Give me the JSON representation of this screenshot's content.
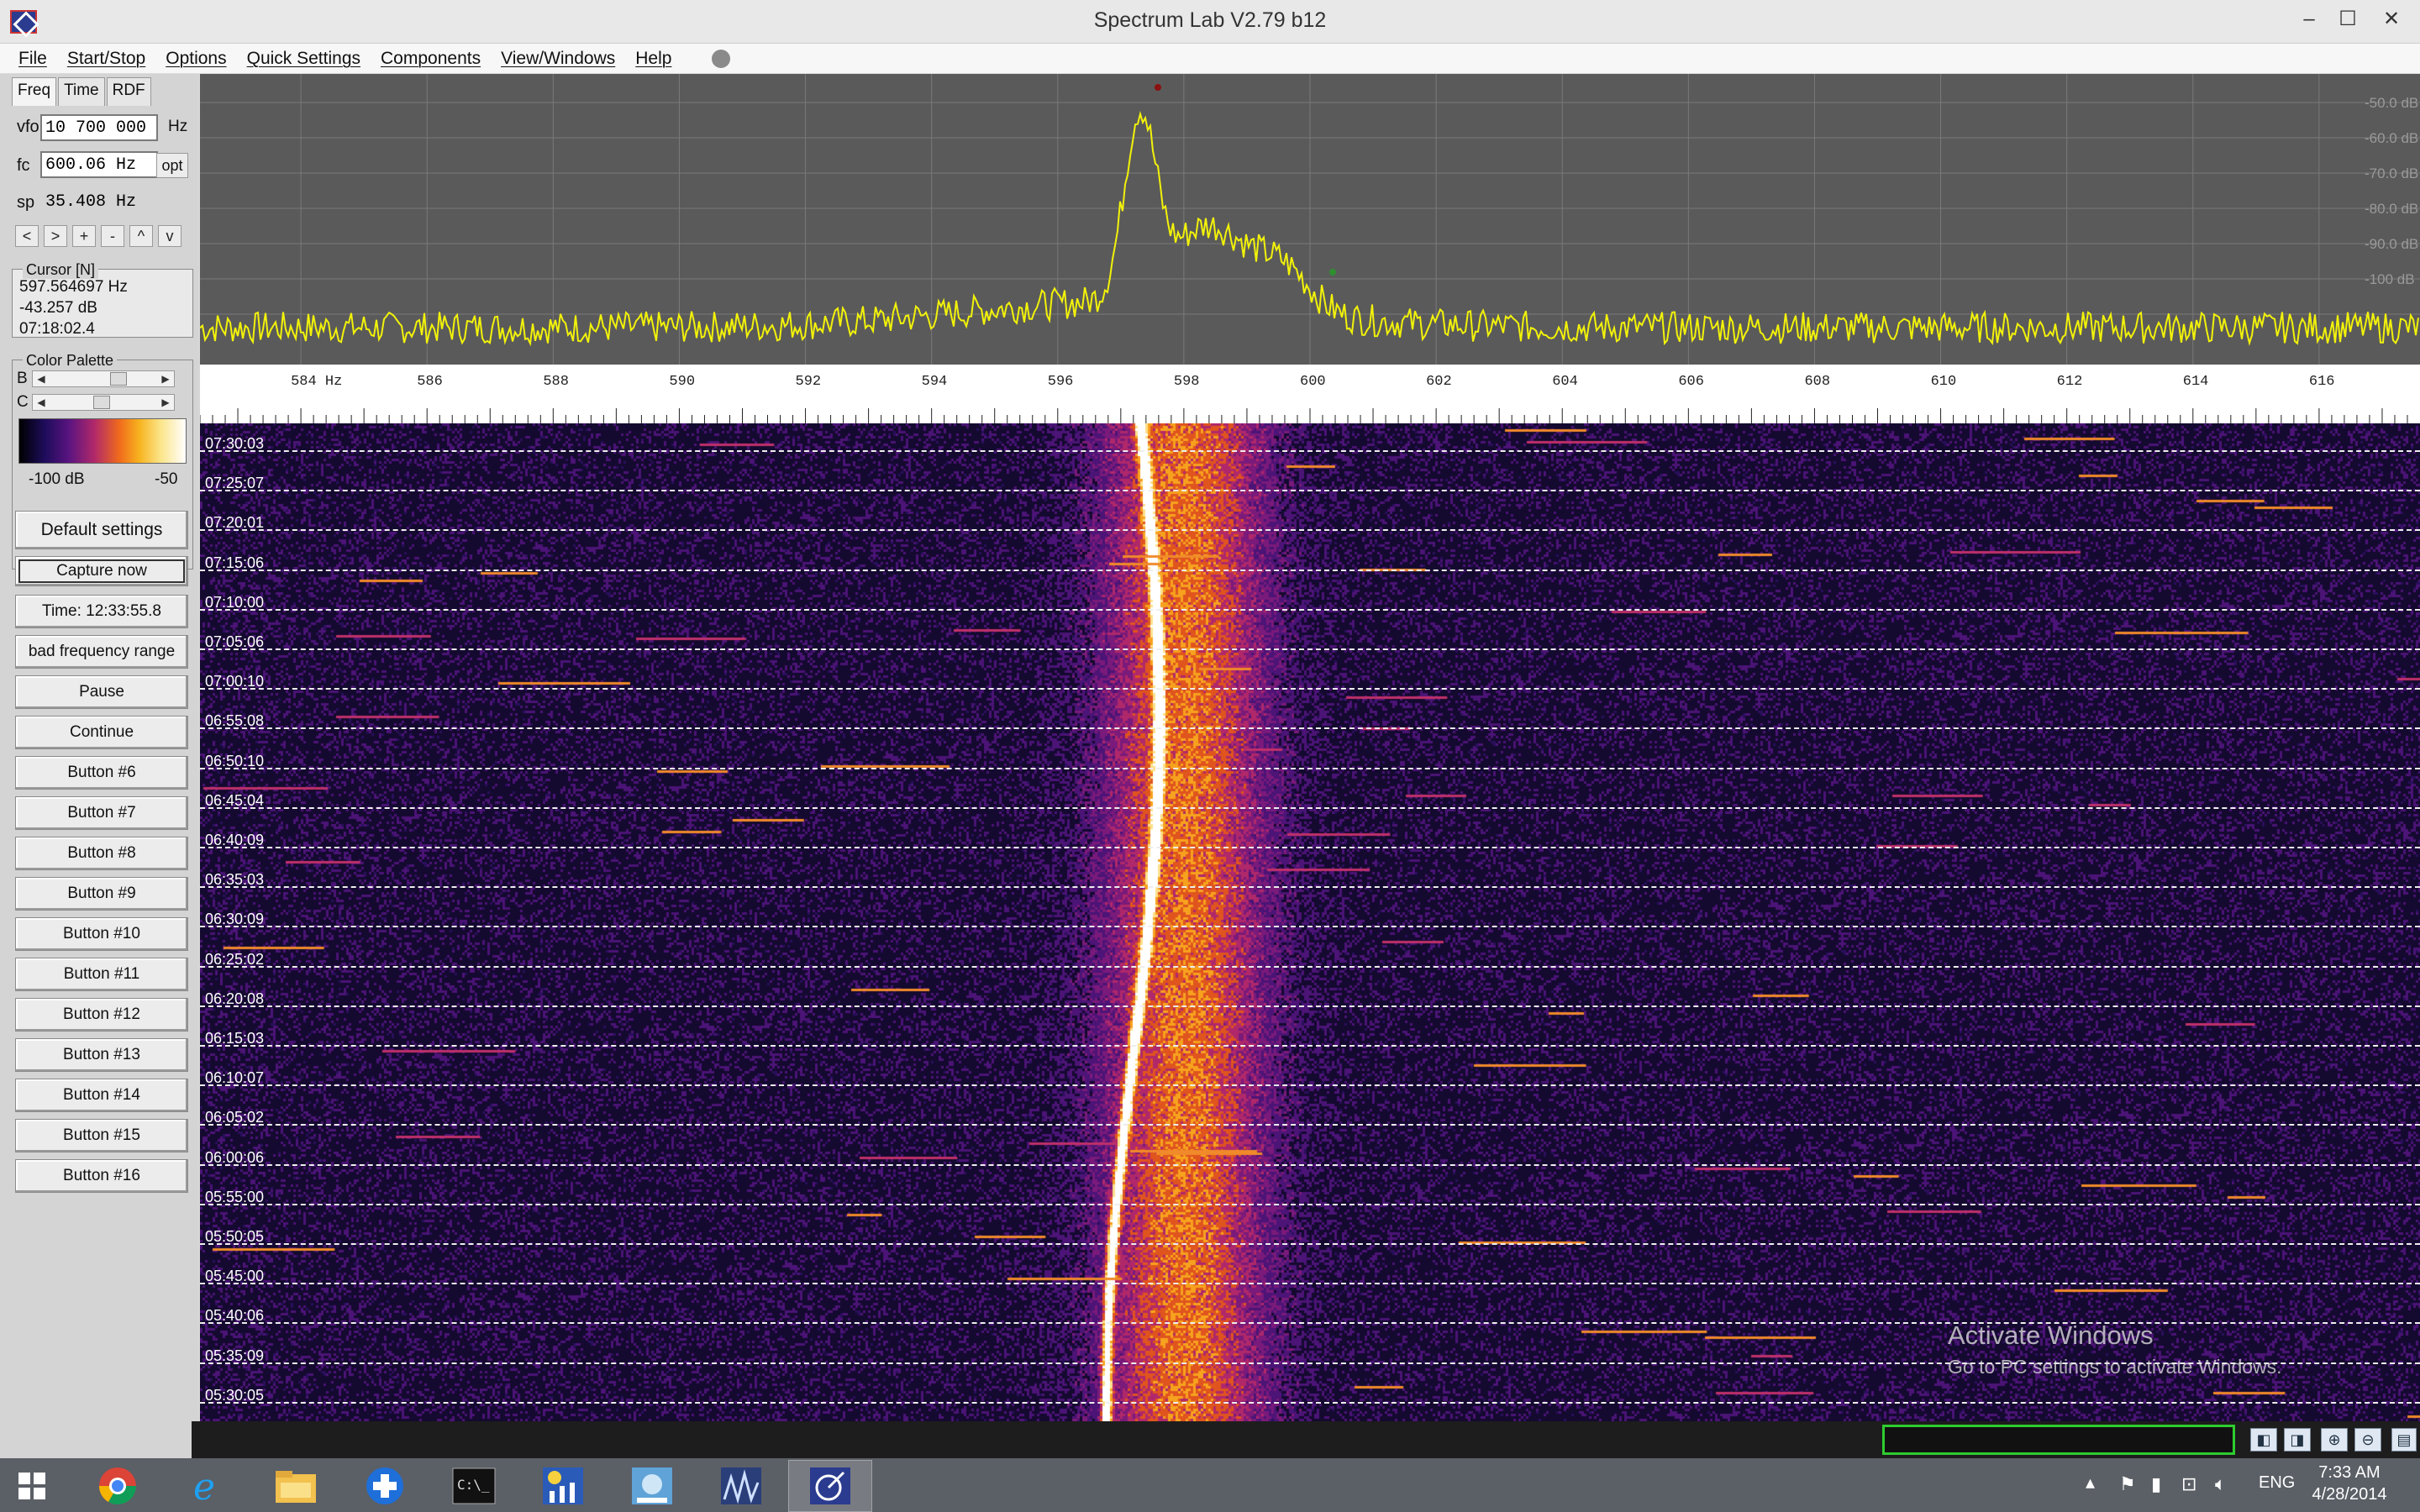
{
  "window": {
    "title": "Spectrum Lab V2.79 b12",
    "controls": {
      "minimize": "–",
      "maximize": "☐",
      "close": "✕"
    }
  },
  "menu": [
    "File",
    "Start/Stop",
    "Options",
    "Quick Settings",
    "Components",
    "View/Windows",
    "Help"
  ],
  "left_panel": {
    "tabs": [
      "Freq",
      "Time",
      "RDF"
    ],
    "vfo": {
      "label": "vfo",
      "value": "10 700 000",
      "unit": "Hz"
    },
    "fc": {
      "label": "fc",
      "value": "600.06 Hz",
      "button": "opt"
    },
    "sp": {
      "label": "sp",
      "value": "35.408 Hz"
    },
    "nav_buttons": [
      "<",
      ">",
      "+",
      "-",
      "^",
      "v"
    ],
    "cursor": {
      "title": "Cursor [N]",
      "frequency": "597.564697 Hz",
      "level": "-43.257 dB",
      "time": "07:18:02.4"
    },
    "color_palette": {
      "title": "Color Palette",
      "b_label": "B",
      "c_label": "C",
      "min_label": "-100 dB",
      "max_label": "-50",
      "colors": [
        "#000000",
        "#1d0c5a",
        "#5a1480",
        "#b0286a",
        "#f06a1c",
        "#f7b21e",
        "#fbe58a",
        "#ffffff"
      ]
    },
    "buttons": [
      "Default settings",
      "Capture now",
      "Time:  12:33:55.8",
      "bad frequency range",
      "Pause",
      "Continue",
      "Button #6",
      "Button #7",
      "Button #8",
      "Button #9",
      "Button #10",
      "Button #11",
      "Button #12",
      "Button #13",
      "Button #14",
      "Button #15",
      "Button #16"
    ]
  },
  "spectrum": {
    "db_labels": [
      "-50.0 dB",
      "-60.0 dB",
      "-70.0 dB",
      "-80.0 dB",
      "-90.0 dB",
      "-100 dB",
      "-"
    ],
    "trace_color": "#f2f20a",
    "background": "#5a5a5a"
  },
  "frequency_axis": {
    "unit": "Hz",
    "min": 582.4,
    "max": 617.6,
    "ticks": [
      "584",
      "586",
      "588",
      "590",
      "592",
      "594",
      "596",
      "598",
      "600",
      "602",
      "604",
      "606",
      "608",
      "610",
      "612",
      "614",
      "616"
    ]
  },
  "waterfall": {
    "times": [
      "07:30:03",
      "07:25:07",
      "07:20:01",
      "07:15:06",
      "07:10:00",
      "07:05:06",
      "07:00:10",
      "06:55:08",
      "06:50:10",
      "06:45:04",
      "06:40:09",
      "06:35:03",
      "06:30:09",
      "06:25:02",
      "06:20:08",
      "06:15:03",
      "06:10:07",
      "06:05:02",
      "06:00:06",
      "05:55:00",
      "05:50:05",
      "05:45:00",
      "05:40:06",
      "05:35:09",
      "05:30:05"
    ]
  },
  "watermark": {
    "title": "Activate Windows",
    "subtitle": "Go to PC settings to activate Windows."
  },
  "taskbar": {
    "apps": [
      "start-icon",
      "chrome-icon",
      "internet-explorer-icon",
      "file-explorer-icon",
      "helper-app-icon",
      "command-prompt-icon",
      "weather-chart-icon",
      "network-icon",
      "spectrum-scope-icon",
      "spectrum-lab-icon"
    ],
    "language": "ENG",
    "time": "7:33 AM",
    "date": "4/28/2014"
  }
}
